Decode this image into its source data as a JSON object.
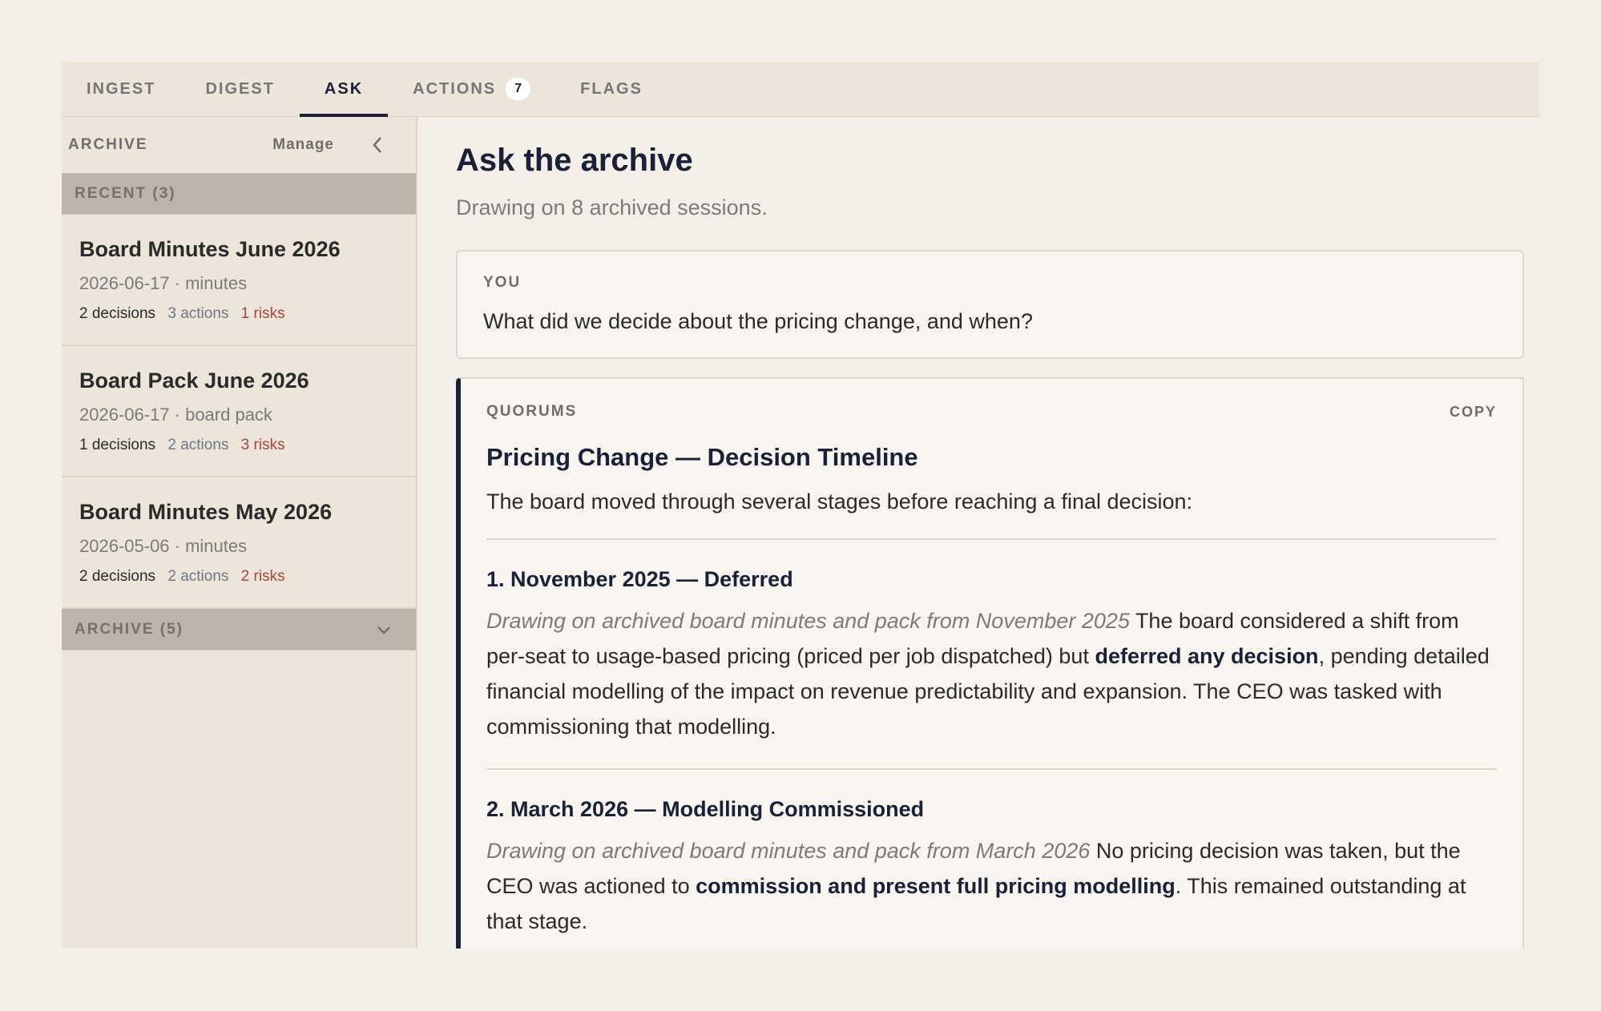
{
  "tabs": {
    "ingest": "INGEST",
    "digest": "DIGEST",
    "ask": "ASK",
    "actions": "ACTIONS",
    "actions_badge": "7",
    "flags": "FLAGS"
  },
  "sidebar": {
    "title": "ARCHIVE",
    "manage": "Manage",
    "recent_label": "RECENT (3)",
    "archive_label": "ARCHIVE (5)",
    "items": [
      {
        "title": "Board Minutes June 2026",
        "meta": "2026-06-17 · minutes",
        "decisions": "2 decisions",
        "actions": "3 actions",
        "risks": "1 risks"
      },
      {
        "title": "Board Pack June 2026",
        "meta": "2026-06-17 · board pack",
        "decisions": "1 decisions",
        "actions": "2 actions",
        "risks": "3 risks"
      },
      {
        "title": "Board Minutes May 2026",
        "meta": "2026-05-06 · minutes",
        "decisions": "2 decisions",
        "actions": "2 actions",
        "risks": "2 risks"
      }
    ]
  },
  "main": {
    "title": "Ask the archive",
    "subtitle": "Drawing on 8 archived sessions.",
    "question": {
      "label": "YOU",
      "text": "What did we decide about the pricing change, and when?"
    },
    "answer": {
      "label": "QUORUMS",
      "copy": "COPY",
      "title": "Pricing Change — Decision Timeline",
      "intro": "The board moved through several stages before reaching a final decision:",
      "sections": [
        {
          "title": "1. November 2025 — Deferred",
          "source": "Drawing on archived board minutes and pack from November 2025",
          "text_a": " The board considered a shift from per-seat to usage-based pricing (priced per job dispatched) but ",
          "bold": "deferred any decision",
          "text_b": ", pending detailed financial modelling of the impact on revenue predictability and expansion. The CEO was tasked with commissioning that modelling."
        },
        {
          "title": "2. March 2026 — Modelling Commissioned",
          "source": "Drawing on archived board minutes and pack from March 2026",
          "text_a": " No pricing decision was taken, but the CEO was actioned to ",
          "bold": "commission and present full pricing modelling",
          "text_b": ". This remained outstanding at that stage."
        }
      ]
    }
  },
  "colors": {
    "accent": "#1a2035",
    "risk": "#a8453e",
    "group_header": "#bcb4a8",
    "background": "#f3efe8"
  }
}
